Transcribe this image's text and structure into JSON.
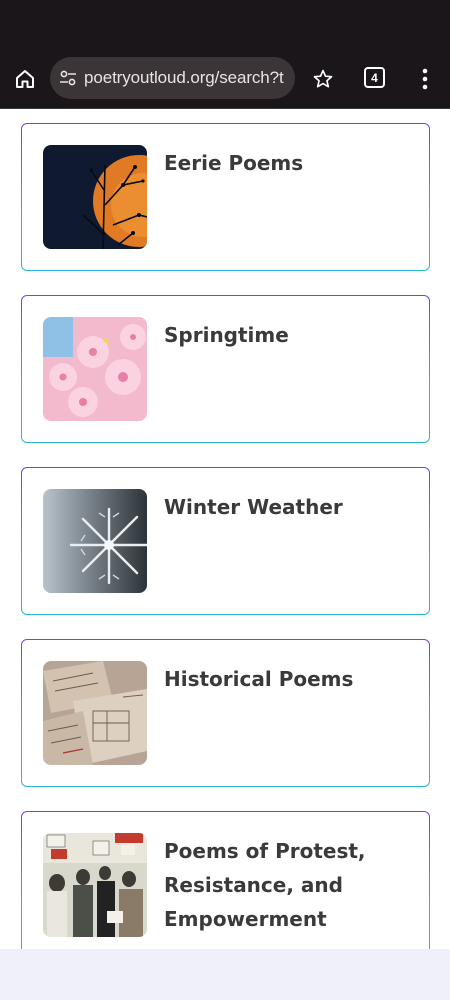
{
  "browser": {
    "url": "poetryoutloud.org/search?t",
    "tab_count": "4",
    "icons": {
      "home": "home-icon",
      "site_info": "tune-icon",
      "bookmark": "star-icon",
      "menu": "more-vert-icon"
    }
  },
  "cards": [
    {
      "title": "Eerie Poems",
      "image": "orange-moon-behind-branches"
    },
    {
      "title": "Springtime",
      "image": "pink-cherry-blossoms"
    },
    {
      "title": "Winter Weather",
      "image": "snowflake-closeup"
    },
    {
      "title": "Historical Poems",
      "image": "old-maps-and-papers"
    },
    {
      "title": "Poems of Protest, Resistance, and Empowerment",
      "image": "civil-rights-march-crowd"
    }
  ],
  "colors": {
    "browser_bar": "#1b1619",
    "url_pill": "#3b3538",
    "card_border_top": "#7b3fd6",
    "card_border_bottom": "#2bb8d0",
    "title_text": "#3a3a3c",
    "bottom_bar": "#f0f0fa"
  }
}
